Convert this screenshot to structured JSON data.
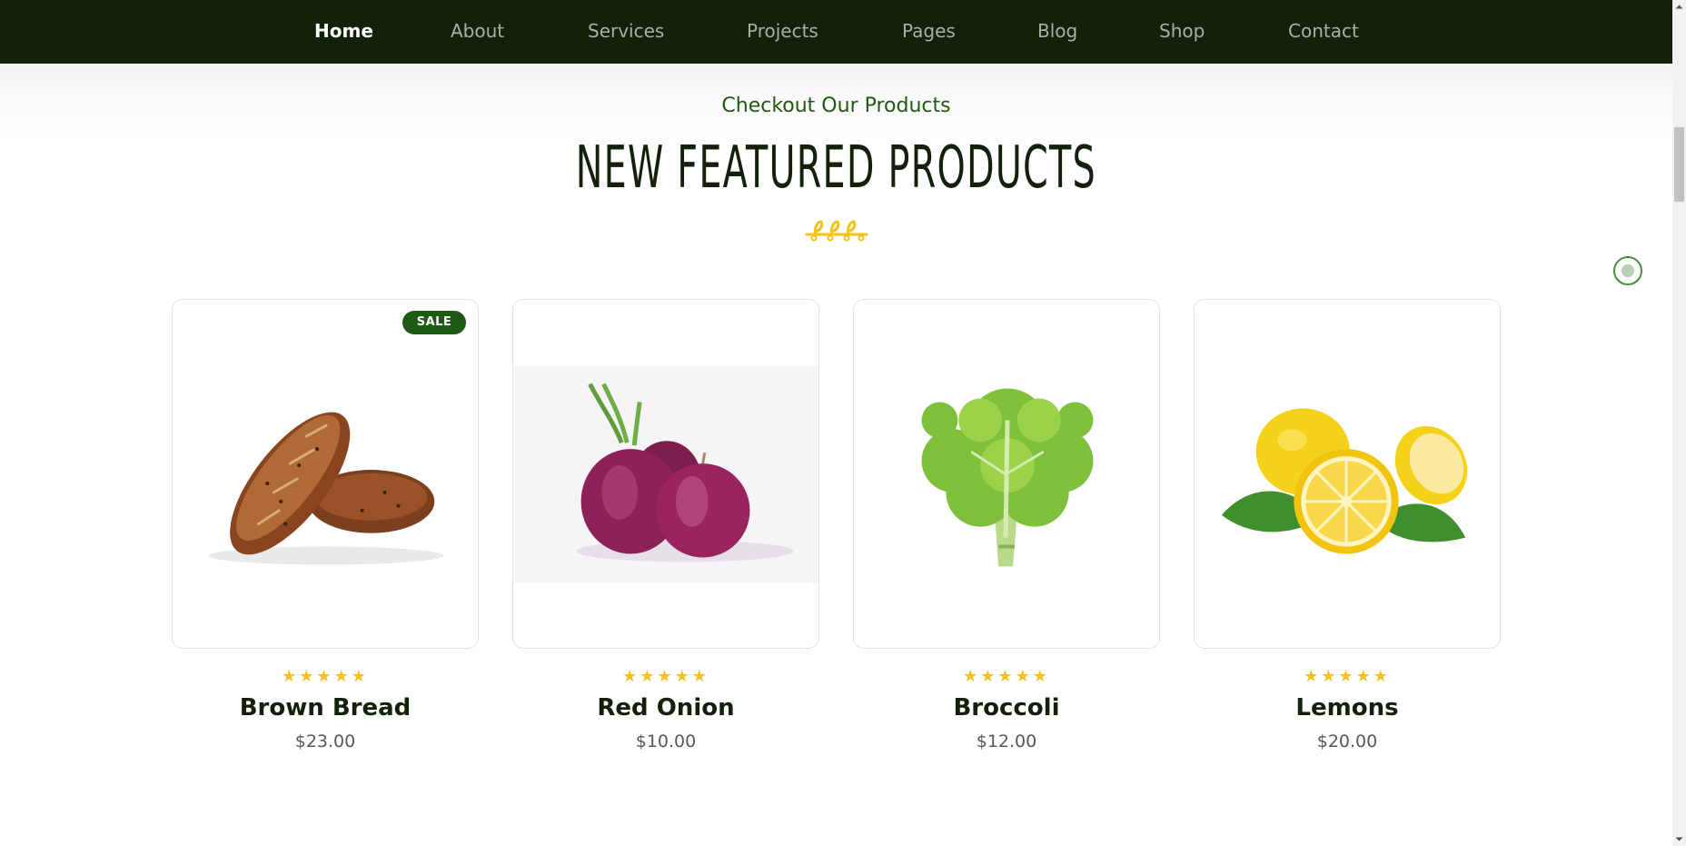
{
  "nav": {
    "items": [
      {
        "label": "Home",
        "active": true
      },
      {
        "label": "About",
        "active": false
      },
      {
        "label": "Services",
        "active": false
      },
      {
        "label": "Projects",
        "active": false
      },
      {
        "label": "Pages",
        "active": false
      },
      {
        "label": "Blog",
        "active": false
      },
      {
        "label": "Shop",
        "active": false
      },
      {
        "label": "Contact",
        "active": false
      }
    ]
  },
  "section": {
    "subtitle": "Checkout Our Products",
    "title": "NEW FEATURED PRODUCTS",
    "ornament_icon": "leaf-vine-ornament-icon"
  },
  "products": [
    {
      "name": "Brown Bread",
      "price": "$23.00",
      "badge": "SALE",
      "rating": 5,
      "image_icon": "bread-image"
    },
    {
      "name": "Red Onion",
      "price": "$10.00",
      "badge": "",
      "rating": 5,
      "image_icon": "red-onion-image"
    },
    {
      "name": "Broccoli",
      "price": "$12.00",
      "badge": "",
      "rating": 5,
      "image_icon": "lettuce-image"
    },
    {
      "name": "Lemons",
      "price": "$20.00",
      "badge": "",
      "rating": 5,
      "image_icon": "lemons-image"
    }
  ],
  "colors": {
    "nav_bg": "#13200a",
    "accent_green": "#1d5a12",
    "star_yellow": "#f4c21a",
    "heading_dark": "#13200a"
  }
}
